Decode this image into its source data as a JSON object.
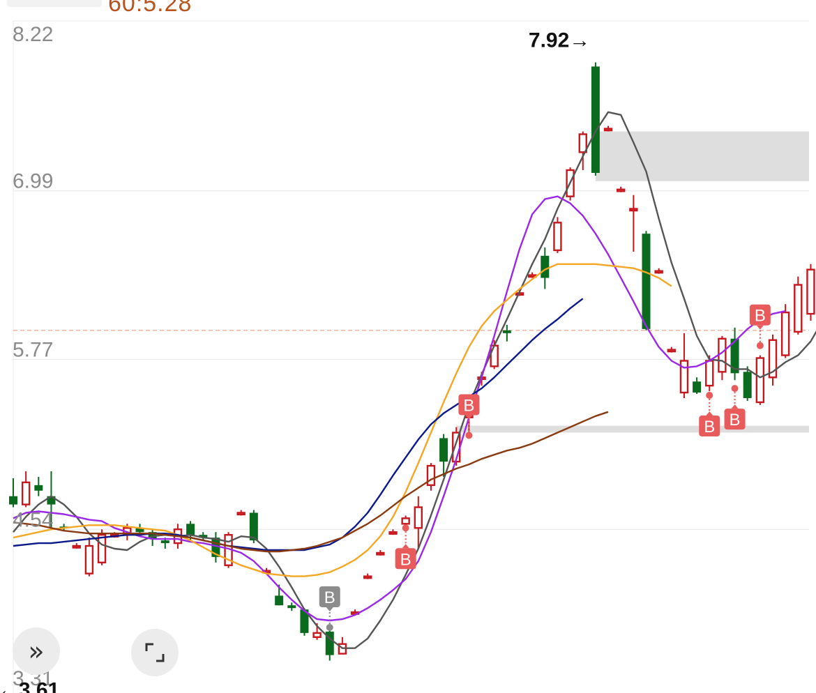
{
  "header": {
    "label": "60:5.28"
  },
  "controls": {
    "expand_glyph": "»",
    "fullscreen_icon": "fullscreen-corners"
  },
  "signal_marker": "B",
  "chart_data": {
    "type": "candlestick",
    "y_axis": {
      "ticks": [
        "8.22",
        "6.99",
        "5.77",
        "4.54",
        "3.31"
      ],
      "ylim": [
        3.31,
        8.22
      ]
    },
    "high_marker": {
      "label": "7.92→",
      "value": 7.92
    },
    "low_marker": {
      "label": "←3.61",
      "value": 3.61
    },
    "reference_price": 5.98,
    "candles": [
      [
        4.78,
        4.72,
        4.91,
        4.7
      ],
      [
        4.72,
        4.88,
        4.96,
        4.7
      ],
      [
        4.86,
        4.82,
        4.92,
        4.78
      ],
      [
        4.78,
        4.72,
        4.96,
        4.55
      ],
      [
        4.56,
        4.55,
        4.58,
        4.53
      ],
      [
        4.42,
        4.42,
        4.44,
        4.4
      ],
      [
        4.22,
        4.42,
        4.48,
        4.2
      ],
      [
        4.3,
        4.5,
        4.54,
        4.28
      ],
      [
        4.5,
        4.5,
        4.52,
        4.48
      ],
      [
        4.5,
        4.55,
        4.58,
        4.46
      ],
      [
        4.55,
        4.52,
        4.58,
        4.5
      ],
      [
        4.52,
        4.47,
        4.54,
        4.42
      ],
      [
        4.46,
        4.44,
        4.48,
        4.4
      ],
      [
        4.44,
        4.54,
        4.58,
        4.4
      ],
      [
        4.58,
        4.5,
        4.6,
        4.46
      ],
      [
        4.5,
        4.48,
        4.52,
        4.46
      ],
      [
        4.48,
        4.34,
        4.52,
        4.3
      ],
      [
        4.28,
        4.5,
        4.52,
        4.26
      ],
      [
        4.66,
        4.66,
        4.68,
        4.64
      ],
      [
        4.66,
        4.46,
        4.68,
        4.44
      ],
      [
        4.24,
        4.24,
        4.26,
        4.22
      ],
      [
        4.06,
        3.99,
        4.14,
        3.99
      ],
      [
        3.99,
        3.97,
        4.01,
        3.95
      ],
      [
        3.96,
        3.79,
        3.97,
        3.77
      ],
      [
        3.76,
        3.79,
        3.86,
        3.74
      ],
      [
        3.8,
        3.63,
        3.81,
        3.59
      ],
      [
        3.64,
        3.71,
        3.76,
        3.64
      ],
      [
        3.94,
        3.94,
        3.96,
        3.92
      ],
      [
        4.2,
        4.2,
        4.22,
        4.18
      ],
      [
        4.37,
        4.37,
        4.39,
        4.35
      ],
      [
        4.52,
        4.52,
        4.54,
        4.5
      ],
      [
        4.58,
        4.62,
        4.64,
        4.55
      ],
      [
        4.55,
        4.7,
        4.78,
        4.4
      ],
      [
        4.86,
        5.0,
        5.02,
        4.82
      ],
      [
        5.2,
        5.03,
        5.23,
        4.92
      ],
      [
        5.03,
        5.24,
        5.28,
        5.0
      ],
      [
        5.35,
        5.42,
        5.44,
        5.22
      ],
      [
        5.64,
        5.64,
        5.68,
        5.58
      ],
      [
        5.72,
        5.87,
        5.91,
        5.7
      ],
      [
        5.98,
        5.96,
        6.02,
        5.9
      ],
      [
        6.25,
        6.25,
        6.27,
        6.23
      ],
      [
        6.38,
        6.38,
        6.4,
        6.36
      ],
      [
        6.52,
        6.36,
        6.58,
        6.28
      ],
      [
        6.56,
        6.76,
        6.8,
        6.54
      ],
      [
        6.95,
        7.14,
        7.16,
        6.92
      ],
      [
        7.27,
        7.4,
        7.42,
        7.14
      ],
      [
        7.89,
        7.12,
        7.92,
        7.1
      ],
      [
        7.44,
        7.44,
        7.46,
        7.42
      ],
      [
        7.0,
        7.0,
        7.02,
        6.98
      ],
      [
        6.86,
        6.86,
        6.96,
        6.55
      ],
      [
        6.68,
        5.99,
        6.7,
        5.98
      ],
      [
        6.41,
        6.41,
        6.43,
        6.39
      ],
      [
        5.84,
        5.84,
        5.86,
        5.82
      ],
      [
        5.53,
        5.76,
        5.96,
        5.49
      ],
      [
        5.61,
        5.53,
        5.64,
        5.52
      ],
      [
        5.58,
        5.76,
        5.8,
        5.54
      ],
      [
        5.68,
        5.92,
        5.94,
        5.62
      ],
      [
        5.92,
        5.67,
        6.0,
        5.62
      ],
      [
        5.68,
        5.49,
        5.72,
        5.47
      ],
      [
        5.46,
        5.78,
        5.8,
        5.44
      ],
      [
        5.64,
        5.91,
        5.95,
        5.58
      ],
      [
        5.8,
        6.11,
        6.17,
        5.78
      ],
      [
        5.97,
        6.31,
        6.37,
        5.95
      ],
      [
        6.1,
        6.42,
        6.46,
        6.05
      ],
      [
        6.45,
        6.22,
        6.48,
        6.05
      ],
      [
        6.26,
        6.55,
        6.61,
        6.2
      ],
      [
        6.49,
        6.18,
        6.83,
        5.98
      ],
      [
        6.21,
        6.4,
        6.52,
        6.05
      ],
      [
        6.22,
        6.02,
        6.24,
        5.98
      ]
    ],
    "series": [
      {
        "name": "MA5",
        "color": "#555555",
        "values": [
          4.52,
          4.63,
          4.72,
          4.78,
          4.72,
          4.63,
          4.51,
          4.43,
          4.4,
          4.39,
          4.45,
          4.49,
          4.5,
          4.49,
          4.5,
          4.48,
          4.47,
          4.45,
          4.49,
          4.48,
          4.4,
          4.27,
          4.12,
          3.96,
          3.84,
          3.75,
          3.68,
          3.68,
          3.75,
          3.88,
          4.03,
          4.21,
          4.4,
          4.64,
          4.9,
          5.17,
          5.44,
          5.66,
          5.87,
          6.06,
          6.26,
          6.46,
          6.64,
          6.86,
          7.05,
          7.24,
          7.42,
          7.56,
          7.54,
          7.34,
          7.13,
          6.79,
          6.47,
          6.21,
          5.94,
          5.77,
          5.76,
          5.7,
          5.7,
          5.64,
          5.68,
          5.75,
          5.8,
          5.9,
          6.06,
          6.22,
          6.32,
          6.38,
          6.33
        ]
      },
      {
        "name": "MA10",
        "color": "#9b27e8",
        "values": [
          4.62,
          4.66,
          4.67,
          4.66,
          4.65,
          4.63,
          4.61,
          4.6,
          4.55,
          4.52,
          4.49,
          4.47,
          4.47,
          4.47,
          4.45,
          4.44,
          4.42,
          4.4,
          4.37,
          4.31,
          4.22,
          4.12,
          4.03,
          3.95,
          3.89,
          3.88,
          3.89,
          3.92,
          3.97,
          4.03,
          4.1,
          4.18,
          4.31,
          4.52,
          4.78,
          5.05,
          5.35,
          5.64,
          5.94,
          6.26,
          6.57,
          6.82,
          6.93,
          6.95,
          6.9,
          6.81,
          6.68,
          6.53,
          6.36,
          6.19,
          6.01,
          5.86,
          5.76,
          5.71,
          5.72,
          5.76,
          5.82,
          5.9,
          5.99,
          6.06,
          6.1,
          6.12
        ]
      },
      {
        "name": "MA20",
        "color": "#f5a623",
        "values": [
          4.48,
          4.5,
          4.52,
          4.54,
          4.55,
          4.56,
          4.57,
          4.57,
          4.57,
          4.56,
          4.55,
          4.54,
          4.53,
          4.5,
          4.46,
          4.41,
          4.36,
          4.32,
          4.28,
          4.25,
          4.22,
          4.21,
          4.2,
          4.2,
          4.21,
          4.23,
          4.27,
          4.32,
          4.39,
          4.49,
          4.63,
          4.81,
          5.02,
          5.24,
          5.46,
          5.67,
          5.86,
          6.01,
          6.12,
          6.2,
          6.28,
          6.35,
          6.42,
          6.46,
          6.46,
          6.46,
          6.46,
          6.45,
          6.44,
          6.43,
          6.4,
          6.36,
          6.3
        ]
      },
      {
        "name": "MA30",
        "color": "#0b1a8a",
        "values": [
          4.42,
          4.43,
          4.44,
          4.44,
          4.45,
          4.46,
          4.47,
          4.48,
          4.49,
          4.5,
          4.5,
          4.51,
          4.51,
          4.5,
          4.48,
          4.46,
          4.44,
          4.42,
          4.41,
          4.4,
          4.39,
          4.39,
          4.39,
          4.39,
          4.41,
          4.43,
          4.48,
          4.56,
          4.66,
          4.79,
          4.93,
          5.06,
          5.19,
          5.3,
          5.38,
          5.44,
          5.5,
          5.56,
          5.64,
          5.73,
          5.82,
          5.91,
          5.99,
          6.06,
          6.14,
          6.21
        ]
      },
      {
        "name": "MA60",
        "color": "#8b3a0f",
        "values": [
          4.59,
          4.58,
          4.57,
          4.55,
          4.53,
          4.52,
          4.51,
          4.51,
          4.51,
          4.51,
          4.51,
          4.51,
          4.5,
          4.49,
          4.48,
          4.46,
          4.44,
          4.42,
          4.4,
          4.39,
          4.38,
          4.38,
          4.39,
          4.4,
          4.42,
          4.45,
          4.48,
          4.53,
          4.58,
          4.64,
          4.71,
          4.78,
          4.84,
          4.9,
          4.94,
          4.98,
          5.01,
          5.05,
          5.08,
          5.11,
          5.13,
          5.16,
          5.2,
          5.24,
          5.28,
          5.32,
          5.36,
          5.39
        ]
      }
    ],
    "signals": [
      {
        "label": "B",
        "index": 25,
        "value": 3.83,
        "color": "#8c8c8c",
        "dir": "up"
      },
      {
        "label": "B",
        "index": 31,
        "value": 4.55,
        "color": "#e95b5b",
        "dir": "down"
      },
      {
        "label": "B",
        "index": 36,
        "value": 5.22,
        "color": "#e95b5b",
        "dir": "up"
      },
      {
        "label": "B",
        "index": 55,
        "value": 5.51,
        "color": "#e95b5b",
        "dir": "down"
      },
      {
        "label": "B",
        "index": 57,
        "value": 5.56,
        "color": "#e95b5b",
        "dir": "down"
      },
      {
        "label": "B",
        "index": 59,
        "value": 5.87,
        "color": "#e95b5b",
        "dir": "up"
      }
    ],
    "zones": [
      {
        "from_index": 46,
        "top": 7.42,
        "bottom": 7.06
      },
      {
        "from_index": 35,
        "top": 5.29,
        "bottom": 5.24
      }
    ],
    "colors": {
      "up": "#c8161d",
      "down": "#0a6b1e",
      "reference": "#e8a58a",
      "zone": "#dedede"
    }
  }
}
